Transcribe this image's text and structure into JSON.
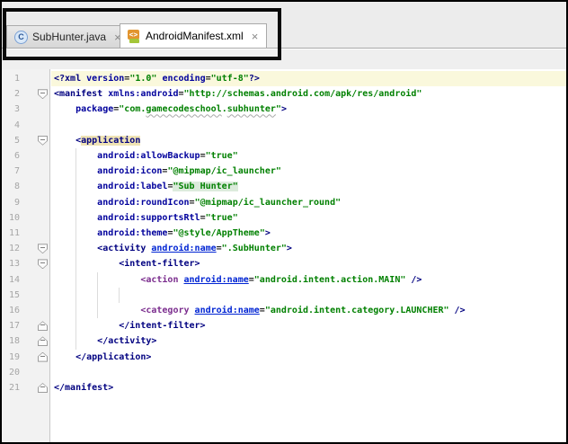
{
  "tabs": {
    "items": [
      {
        "label": "SubHunter.java",
        "icon": "java-class-icon",
        "icon_letter": "C",
        "close_glyph": "×",
        "active": false
      },
      {
        "label": "AndroidManifest.xml",
        "icon": "android-manifest-icon",
        "icon_glyph": "<>",
        "close_glyph": "×",
        "active": true
      }
    ]
  },
  "annotation": {
    "shape": "rectangle",
    "color": "#000000",
    "note": "hand-drawn emphasis box around editor tabs"
  },
  "editor": {
    "language": "xml",
    "colors": {
      "tag": "#000080",
      "special_tag": "#7B2D8E",
      "attribute": "#00009C",
      "name_attribute": "#0024D3",
      "value": "#008000",
      "line_highlight": "#FAF8DC",
      "tag_match_highlight": "#EFE3B4",
      "value_highlight": "#DCEBDC",
      "gutter_bg": "#F2F2F2",
      "line_number": "#A6A6A6"
    },
    "lines": [
      {
        "n": 1,
        "hl": "yellow",
        "fold": null,
        "seg": [
          [
            "<?xml ",
            "tag"
          ],
          [
            "version",
            "attr"
          ],
          [
            "=",
            "plain"
          ],
          [
            "\"1.0\"",
            "val"
          ],
          [
            " ",
            "plain"
          ],
          [
            "encoding",
            "attr"
          ],
          [
            "=",
            "plain"
          ],
          [
            "\"utf-8\"",
            "val"
          ],
          [
            "?>",
            "tag"
          ]
        ]
      },
      {
        "n": 2,
        "hl": null,
        "fold": "open",
        "seg": [
          [
            "<manifest ",
            "tag"
          ],
          [
            "xmlns:android",
            "attr"
          ],
          [
            "=",
            "plain"
          ],
          [
            "\"http://schemas.android.com/apk/res/android\"",
            "val"
          ]
        ]
      },
      {
        "n": 3,
        "hl": null,
        "fold": null,
        "seg": [
          [
            "    ",
            "plain"
          ],
          [
            "package",
            "attr"
          ],
          [
            "=",
            "plain"
          ],
          [
            "\"com.",
            "val"
          ],
          [
            "gamecodeschool",
            "val sq"
          ],
          [
            ".",
            "val"
          ],
          [
            "subhunter",
            "val sq"
          ],
          [
            "\"",
            "val"
          ],
          [
            ">",
            "tag"
          ]
        ]
      },
      {
        "n": 4,
        "hl": null,
        "fold": null,
        "seg": []
      },
      {
        "n": 5,
        "hl": null,
        "fold": "open",
        "seg": [
          [
            "    ",
            "plain"
          ],
          [
            "<",
            "tag"
          ],
          [
            "application",
            "tag bgtan"
          ]
        ]
      },
      {
        "n": 6,
        "hl": null,
        "fold": null,
        "seg": [
          [
            "        ",
            "plain"
          ],
          [
            "android:allowBackup",
            "attr"
          ],
          [
            "=",
            "plain"
          ],
          [
            "\"true\"",
            "val"
          ]
        ]
      },
      {
        "n": 7,
        "hl": null,
        "fold": null,
        "seg": [
          [
            "        ",
            "plain"
          ],
          [
            "android:icon",
            "attr"
          ],
          [
            "=",
            "plain"
          ],
          [
            "\"@mipmap/ic_launcher\"",
            "val"
          ]
        ]
      },
      {
        "n": 8,
        "hl": null,
        "fold": null,
        "seg": [
          [
            "        ",
            "plain"
          ],
          [
            "android:label",
            "attr"
          ],
          [
            "=",
            "plain"
          ],
          [
            "\"Sub Hunter\"",
            "val bggreen"
          ]
        ]
      },
      {
        "n": 9,
        "hl": null,
        "fold": null,
        "seg": [
          [
            "        ",
            "plain"
          ],
          [
            "android:roundIcon",
            "attr"
          ],
          [
            "=",
            "plain"
          ],
          [
            "\"@mipmap/ic_launcher_round\"",
            "val"
          ]
        ]
      },
      {
        "n": 10,
        "hl": null,
        "fold": null,
        "seg": [
          [
            "        ",
            "plain"
          ],
          [
            "android:supportsRtl",
            "attr"
          ],
          [
            "=",
            "plain"
          ],
          [
            "\"true\"",
            "val"
          ]
        ]
      },
      {
        "n": 11,
        "hl": null,
        "fold": null,
        "seg": [
          [
            "        ",
            "plain"
          ],
          [
            "android:theme",
            "attr"
          ],
          [
            "=",
            "plain"
          ],
          [
            "\"@style/AppTheme\"",
            "val"
          ],
          [
            ">",
            "tag"
          ]
        ]
      },
      {
        "n": 12,
        "hl": null,
        "fold": "open",
        "seg": [
          [
            "        ",
            "plain"
          ],
          [
            "<activity ",
            "tag"
          ],
          [
            "android:name",
            "name"
          ],
          [
            "=",
            "plain"
          ],
          [
            "\".SubHunter\"",
            "val"
          ],
          [
            ">",
            "tag"
          ]
        ]
      },
      {
        "n": 13,
        "hl": null,
        "fold": "open",
        "seg": [
          [
            "            ",
            "plain"
          ],
          [
            "<intent-filter>",
            "tag"
          ]
        ]
      },
      {
        "n": 14,
        "hl": null,
        "fold": null,
        "seg": [
          [
            "                ",
            "plain"
          ],
          [
            "<action ",
            "tagp"
          ],
          [
            "android:name",
            "name"
          ],
          [
            "=",
            "plain"
          ],
          [
            "\"android.intent.action.MAIN\"",
            "val"
          ],
          [
            " />",
            "tag"
          ]
        ]
      },
      {
        "n": 15,
        "hl": null,
        "fold": null,
        "seg": []
      },
      {
        "n": 16,
        "hl": null,
        "fold": null,
        "seg": [
          [
            "                ",
            "plain"
          ],
          [
            "<category ",
            "tagp"
          ],
          [
            "android:name",
            "name"
          ],
          [
            "=",
            "plain"
          ],
          [
            "\"android.intent.category.LAUNCHER\"",
            "val"
          ],
          [
            " />",
            "tag"
          ]
        ]
      },
      {
        "n": 17,
        "hl": null,
        "fold": "close",
        "seg": [
          [
            "            ",
            "plain"
          ],
          [
            "</intent-filter>",
            "tag"
          ]
        ]
      },
      {
        "n": 18,
        "hl": null,
        "fold": "close",
        "seg": [
          [
            "        ",
            "plain"
          ],
          [
            "</activity>",
            "tag"
          ]
        ]
      },
      {
        "n": 19,
        "hl": null,
        "fold": "close",
        "seg": [
          [
            "    ",
            "plain"
          ],
          [
            "</application>",
            "tag"
          ]
        ]
      },
      {
        "n": 20,
        "hl": null,
        "fold": null,
        "seg": []
      },
      {
        "n": 21,
        "hl": null,
        "fold": "close",
        "seg": [
          [
            "</manifest>",
            "tag"
          ]
        ]
      }
    ]
  }
}
